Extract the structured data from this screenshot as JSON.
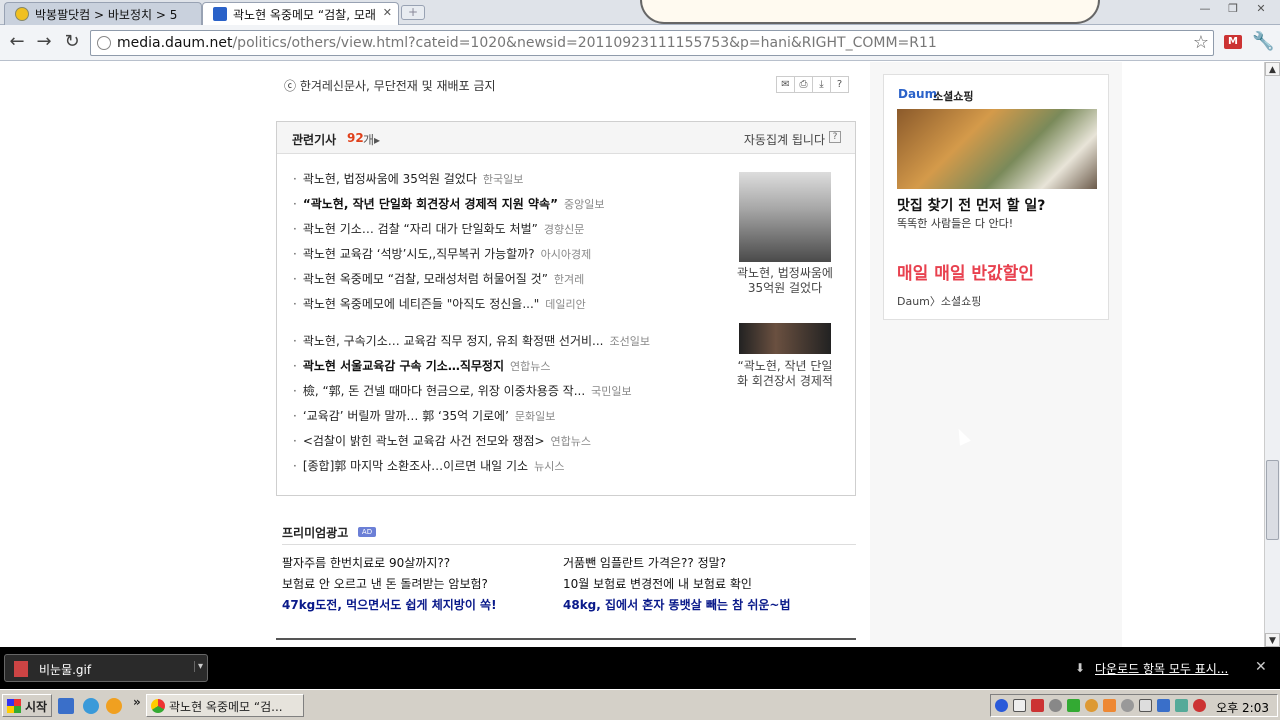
{
  "browser": {
    "tabs": [
      {
        "title": "박봉팔닷컴 > 바보정치 > 5",
        "active": false
      },
      {
        "title": "곽노현 옥중메모 “검찰, 모래",
        "active": true
      }
    ],
    "url": {
      "host": "media.daum.net",
      "path": "/politics/others/view.html?cateid=1020&newsid=20110923111155753&p=hani&RIGHT_COMM=R11"
    }
  },
  "article": {
    "copyright": "ⓒ 한겨레신문사, 무단전재 및 재배포 금지",
    "tool_icons": [
      "mail-icon",
      "print-icon",
      "download-icon",
      "help-icon"
    ]
  },
  "related": {
    "title": "관련기사",
    "count": "92",
    "count_unit": "개",
    "auto_note": "자동집계 됩니다",
    "group1": [
      {
        "title": "곽노현, 법정싸움에 35억원 걸었다",
        "source": "한국일보",
        "bold": false
      },
      {
        "title": "“곽노현, 작년 단일화 회견장서 경제적 지원 약속”",
        "source": "중앙일보",
        "bold": true
      },
      {
        "title": "곽노현 기소… 검찰 “자리 대가 단일화도 처벌”",
        "source": "경향신문",
        "bold": false
      },
      {
        "title": "곽노현 교육감 ‘석방’시도,,직무복귀 가능할까?",
        "source": "아시아경제",
        "bold": false
      },
      {
        "title": "곽노현 옥중메모 “검찰, 모래성처럼 허물어질 것”",
        "source": "한겨레",
        "bold": false
      },
      {
        "title": "곽노현 옥중메모에 네티즌들 \"아직도 정신을...\"",
        "source": "데일리안",
        "bold": false
      }
    ],
    "group2": [
      {
        "title": "곽노현, 구속기소… 교육감 직무 정지, 유죄 확정땐 선거비...",
        "source": "조선일보",
        "bold": false
      },
      {
        "title": "곽노현 서울교육감 구속 기소…직무정지",
        "source": "연합뉴스",
        "bold": true
      },
      {
        "title": "檢, “郭, 돈 건넬 때마다 현금으로, 위장 이중차용증 작...",
        "source": "국민일보",
        "bold": false
      },
      {
        "title": "‘교육감’ 버릴까 말까… 郭 ‘35억 기로에’",
        "source": "문화일보",
        "bold": false
      },
      {
        "title": "<검찰이 밝힌 곽노현 교육감 사건 전모와 쟁점>",
        "source": "연합뉴스",
        "bold": false
      },
      {
        "title": "[종합]郭 마지막 소환조사…이르면 내일 기소",
        "source": "뉴시스",
        "bold": false
      }
    ],
    "thumb1_caption_l1": "곽노현, 법정싸움에",
    "thumb1_caption_l2": "35억원 걸었다",
    "thumb2_caption_l1": "“곽노현, 작년 단일",
    "thumb2_caption_l2": "화 회견장서 경제적"
  },
  "premium": {
    "title": "프리미엄광고",
    "badge": "AD",
    "left": [
      {
        "text": "팔자주름 한번치료로 90살까지??",
        "bold": false
      },
      {
        "text": "보험료 안 오르고 낸 돈 돌려받는 암보험?",
        "bold": false
      },
      {
        "text": "47kg도전, 먹으면서도 쉽게 체지방이 쏙!",
        "bold": true
      }
    ],
    "right": [
      {
        "text": "거품뺀 임플란트 가격은?? 정말?",
        "bold": false
      },
      {
        "text": "10월 보험료 변경전에 내 보험료 확인",
        "bold": false
      },
      {
        "text": "48kg, 집에서 혼자 똥뱃살 빼는 참 쉬운~법",
        "bold": true
      }
    ]
  },
  "side_ad": {
    "logo": "Daum",
    "label": "소셜쇼핑",
    "headline": "맛집 찾기 전 먼저 할 일?",
    "sub": "똑똑한 사람들은 다 안다!",
    "sale": "매일 매일 반값할인",
    "footer": "Daum〉소셜쇼핑"
  },
  "downloads": {
    "file": "비눈물.gif",
    "show_all": "다운로드 항목 모두 표시..."
  },
  "taskbar": {
    "start": "시작",
    "task": "곽노현 옥중메모 “검...",
    "clock": "오후 2:03"
  }
}
